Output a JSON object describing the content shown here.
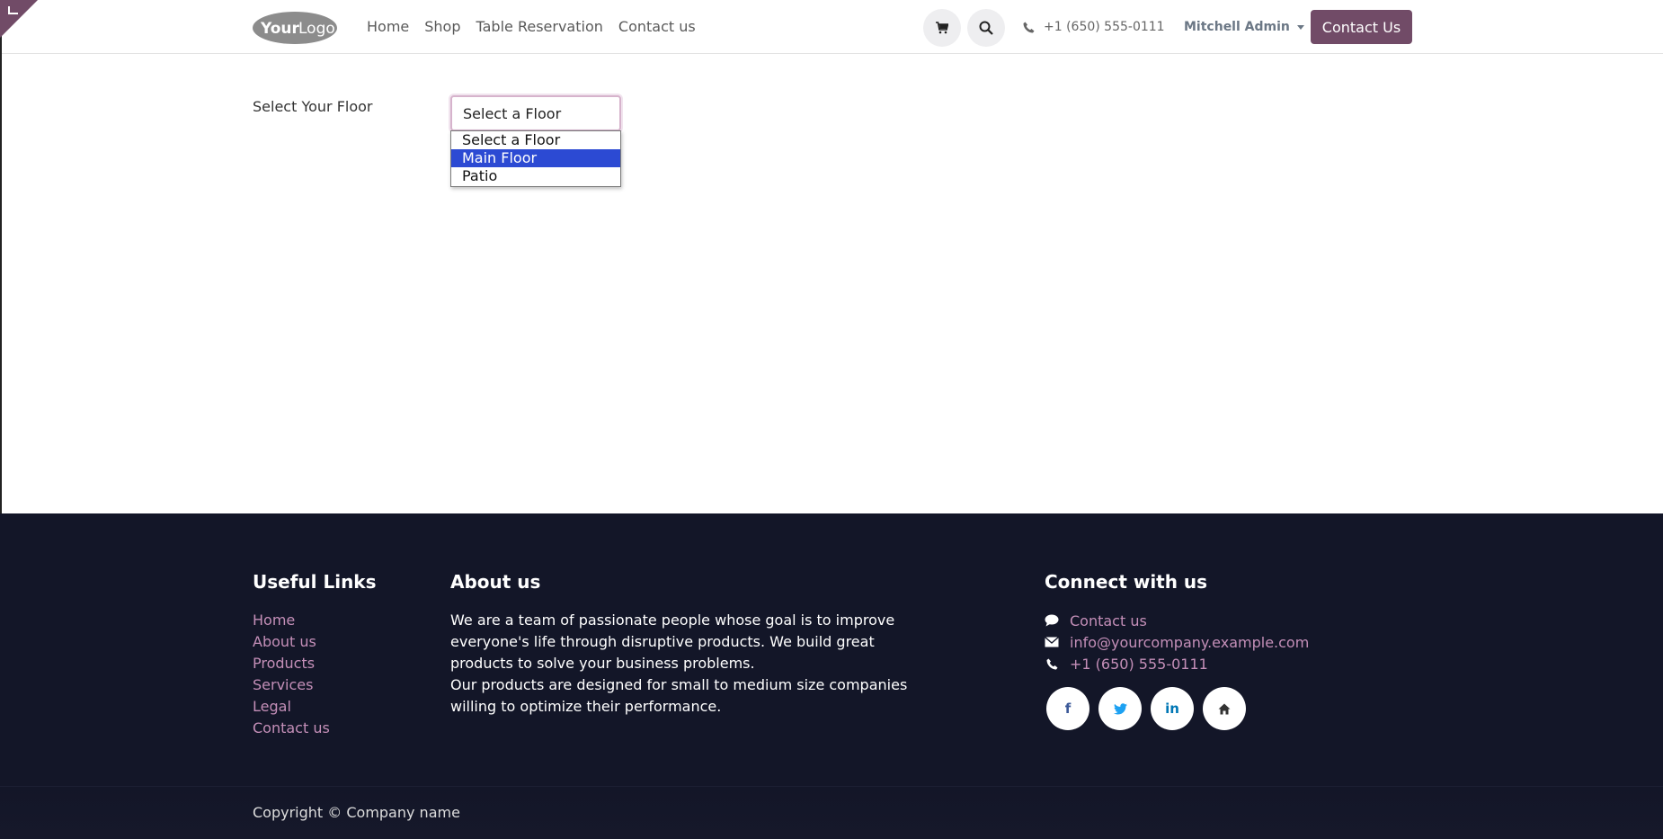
{
  "header": {
    "logo_text": "YourLogo",
    "nav": [
      "Home",
      "Shop",
      "Table Reservation",
      "Contact us"
    ],
    "phone": "+1 (650) 555-0111",
    "user": "Mitchell Admin",
    "contact_button": "Contact Us",
    "icons": [
      "cart-icon",
      "search-icon",
      "phone-icon"
    ]
  },
  "main": {
    "floor_label": "Select Your Floor",
    "select_value": "Select a Floor",
    "options": [
      "Select a Floor",
      "Main Floor",
      "Patio"
    ],
    "highlighted_option": "Main Floor"
  },
  "footer": {
    "useful_links_title": "Useful Links",
    "useful_links": [
      "Home",
      "About us",
      "Products",
      "Services",
      "Legal",
      "Contact us"
    ],
    "about_title": "About us",
    "about_p1": "We are a team of passionate people whose goal is to improve everyone's life through disruptive products. We build great products to solve your business problems.",
    "about_p2": "Our products are designed for small to medium size companies willing to optimize their performance.",
    "connect_title": "Connect with us",
    "connect_contact": "Contact us",
    "connect_email": "info@yourcompany.example.com",
    "connect_phone": "+1 (650) 555-0111",
    "socials": [
      {
        "icon": "facebook-icon",
        "glyph": "f",
        "color": "#3b5998"
      },
      {
        "icon": "twitter-icon",
        "glyph": "🐦",
        "color": "#1da1f2"
      },
      {
        "icon": "linkedin-icon",
        "glyph": "in",
        "color": "#0077b5"
      },
      {
        "icon": "home-icon",
        "glyph": "⌂",
        "color": "#333333"
      }
    ],
    "copyright": "Copyright © Company name"
  },
  "colors": {
    "brand": "#714b67",
    "link": "#c48fb8",
    "footer_bg": "#131628",
    "select_highlight": "#2c4ad3"
  }
}
